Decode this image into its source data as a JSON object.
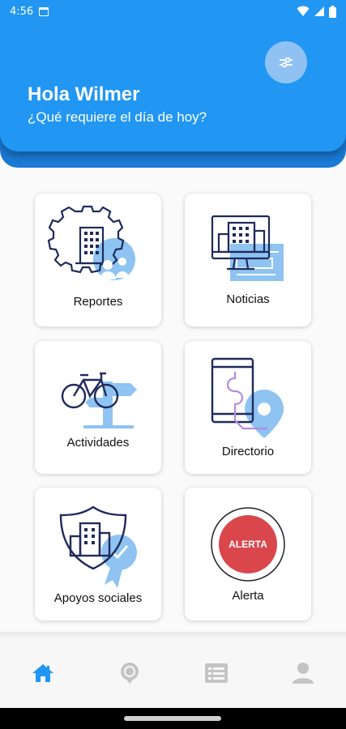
{
  "status_bar": {
    "time": "4:56"
  },
  "header": {
    "greeting": "Hola Wilmer",
    "subtitle": "¿Qué requiere el día de hoy?"
  },
  "cards": [
    {
      "label": "Reportes",
      "icon": "reports-gear-icon"
    },
    {
      "label": "Noticias",
      "icon": "news-monitor-icon"
    },
    {
      "label": "Actividades",
      "icon": "bicycle-icon"
    },
    {
      "label": "Directorio",
      "icon": "phone-map-icon"
    },
    {
      "label": "Apoyos sociales",
      "icon": "shield-building-icon"
    },
    {
      "label": "Alerta",
      "icon": "alert-button-icon",
      "badge": "ALERTA"
    }
  ],
  "bottom_nav": [
    {
      "name": "home",
      "active": true
    },
    {
      "name": "location",
      "active": false
    },
    {
      "name": "list",
      "active": false
    },
    {
      "name": "profile",
      "active": false
    }
  ],
  "colors": {
    "primary": "#2196f3",
    "illustration_blue": "#8ec3f2",
    "illustration_navy": "#1f2a5c",
    "alert_red": "#d9474c",
    "nav_inactive": "#c4c4c4"
  }
}
